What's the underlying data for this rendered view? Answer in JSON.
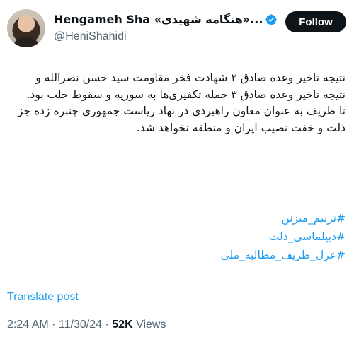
{
  "author": {
    "display_name": "Hengameh Sha «هنگامه شهیدی»...",
    "handle": "@HeniShahidi",
    "verified": true
  },
  "follow_button": {
    "label": "Follow"
  },
  "tweet": {
    "lines": [
      "نتیجه تاخیر وعده صادق ۲ شهادت فخر مقاومت سید حسن نصرالله و",
      "نتیجه تاخیر وعده صادق ۳ حمله تکفیری‌ها به سوریه و سقوط حلب بود.",
      "تا ظریف به عنوان معاون راهبردی در نهاد ریاست جمهوری چنبره زده جز ذلت و خفت نصیب ایران و منطقه نخواهد شد."
    ],
    "hashtags": [
      "#نزنیم_میزنن",
      "#دیپلماسی_ذلت",
      "#عزل_ظریف_مطالبه_ملی"
    ]
  },
  "translate_link": "Translate post",
  "meta": {
    "time": "2:24 AM",
    "separator": "·",
    "date": "11/30/24",
    "views_count": "52K",
    "views_label": "Views"
  },
  "colors": {
    "link": "#1d9bf0",
    "text": "#0f1419",
    "muted": "#536471",
    "follow_bg": "#0f1419"
  }
}
